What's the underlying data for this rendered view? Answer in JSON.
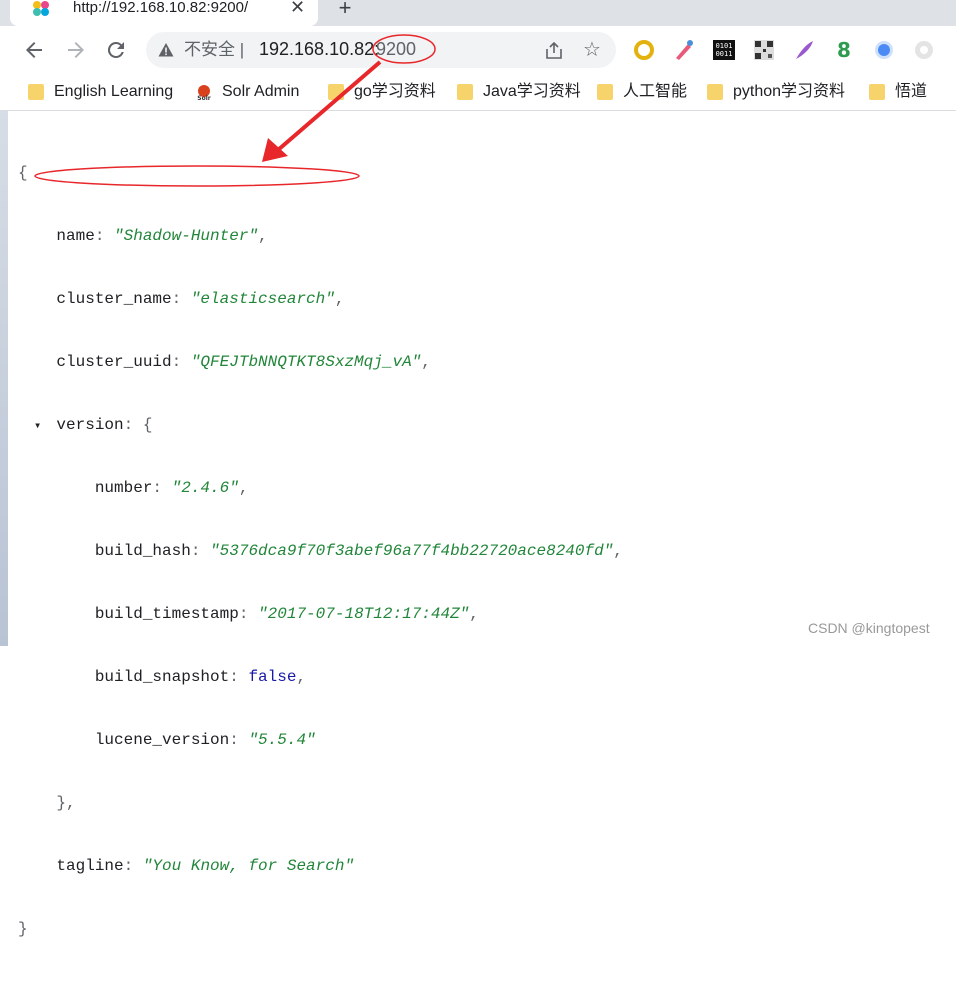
{
  "tab": {
    "title": "http://192.168.10.82:9200/",
    "close_glyph": "✕",
    "new_tab_glyph": "+"
  },
  "toolbar": {
    "back_icon": "back-arrow-icon",
    "forward_icon": "forward-arrow-icon",
    "reload_icon": "reload-icon",
    "security_text": "不安全 |",
    "url_host": "192.168.10.82:",
    "url_port": "9200"
  },
  "bookmarks": [
    {
      "label": "English Learning",
      "icon": "folder-icon"
    },
    {
      "label": "Solr Admin",
      "icon": "solr-logo-icon"
    },
    {
      "label": "go学习资料",
      "icon": "folder-icon"
    },
    {
      "label": "Java学习资料",
      "icon": "folder-icon"
    },
    {
      "label": "人工智能",
      "icon": "folder-icon"
    },
    {
      "label": "python学习资料",
      "icon": "folder-icon"
    },
    {
      "label": "悟道",
      "icon": "folder-icon"
    }
  ],
  "json": {
    "name_key": "name",
    "name_val": "\"Shadow-Hunter\"",
    "cluster_name_key": "cluster_name",
    "cluster_name_val": "\"elasticsearch\"",
    "cluster_uuid_key": "cluster_uuid",
    "cluster_uuid_val": "\"QFEJTbNNQTKT8SxzMqj_vA\"",
    "version_key": "version",
    "number_key": "number",
    "number_val": "\"2.4.6\"",
    "build_hash_key": "build_hash",
    "build_hash_val": "\"5376dca9f70f3abef96a77f4bb22720ace8240fd\"",
    "build_timestamp_key": "build_timestamp",
    "build_timestamp_val": "\"2017-07-18T12:17:44Z\"",
    "build_snapshot_key": "build_snapshot",
    "build_snapshot_val": "false",
    "lucene_version_key": "lucene_version",
    "lucene_version_val": "\"5.5.4\"",
    "tagline_key": "tagline",
    "tagline_val": "\"You Know, for Search\""
  },
  "watermark": "CSDN @kingtopest",
  "colors": {
    "annotation_red": "#e8272b",
    "json_string": "#22863a",
    "json_bool": "#1a1aa6"
  }
}
